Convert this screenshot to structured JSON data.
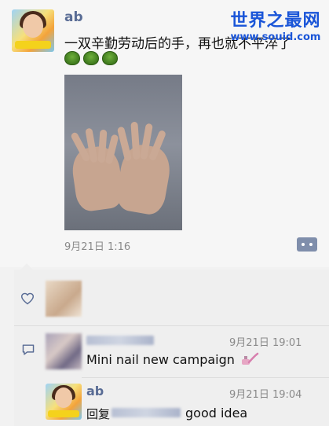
{
  "watermark": {
    "title": "世界之最网",
    "url": "www.souid.com"
  },
  "post": {
    "username": "ab",
    "text": "一双辛勤劳动后的手，再也就不平淬了",
    "emoji": [
      "turtle",
      "turtle",
      "turtle"
    ],
    "photo_subject": "two hands resting palm-down",
    "timestamp": "9月21日 1:16"
  },
  "likes": {
    "icon": "heart-icon"
  },
  "comments": [
    {
      "author": "",
      "time": "9月21日 19:01",
      "text": "Mini nail new campaign",
      "icon": "nail-polish-icon"
    },
    {
      "author": "ab",
      "time": "9月21日 19:04",
      "reply_prefix": "回复",
      "text": "good idea"
    }
  ],
  "colors": {
    "name_blue": "#596c95",
    "meta_gray": "#8a8a8a",
    "watermark_blue": "#1a55d8"
  }
}
